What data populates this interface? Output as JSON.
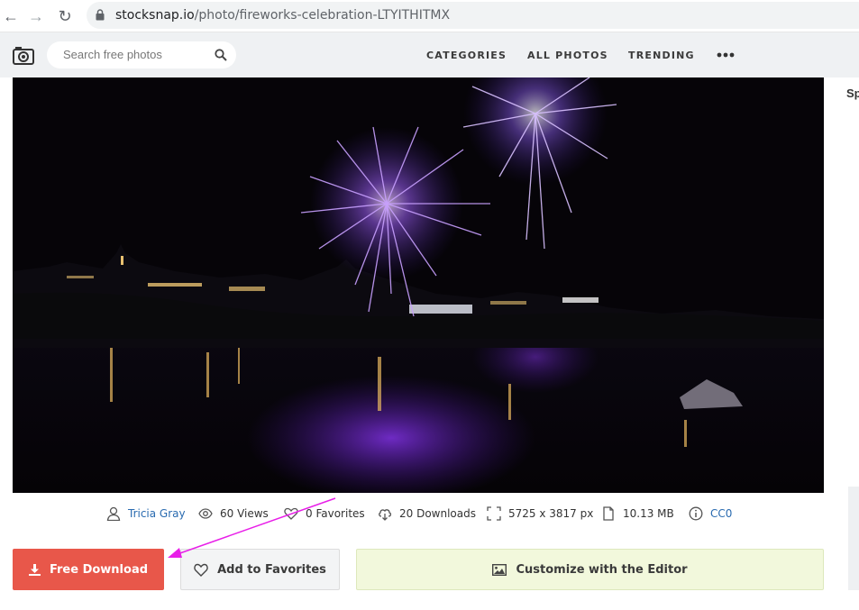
{
  "browser": {
    "url_domain": "stocksnap.io",
    "url_path": "/photo/fireworks-celebration-LTYITHITMX"
  },
  "header": {
    "search_placeholder": "Search free photos",
    "nav": {
      "categories": "CATEGORIES",
      "all_photos": "ALL PHOTOS",
      "trending": "TRENDING"
    }
  },
  "sidebar_partial": {
    "text": "Sp"
  },
  "stats": {
    "author": "Tricia Gray",
    "views": "60 Views",
    "favorites": "0 Favorites",
    "downloads": "20 Downloads",
    "dimensions": "5725 x 3817 px",
    "file_size": "10.13 MB",
    "license": "CC0"
  },
  "actions": {
    "download": "Free Download",
    "favorites": "Add to Favorites",
    "editor": "Customize with the Editor"
  },
  "colors": {
    "download_button": "#e8574a",
    "editor_button": "#f2f8dc",
    "annotation_arrow": "#e81ee8",
    "link": "#2a6bb0"
  },
  "icons": {
    "back": "arrow-left-icon",
    "forward": "arrow-right-icon",
    "reload": "reload-icon",
    "lock": "lock-icon",
    "logo": "camera-icon",
    "search": "search-icon",
    "more": "more-dots-icon",
    "author": "user-icon",
    "views": "eye-icon",
    "favorites": "heart-icon",
    "downloads": "cloud-download-icon",
    "dimensions": "expand-icon",
    "file_size": "file-icon",
    "license": "info-icon",
    "download_button": "download-icon",
    "editor_button": "image-icon"
  }
}
